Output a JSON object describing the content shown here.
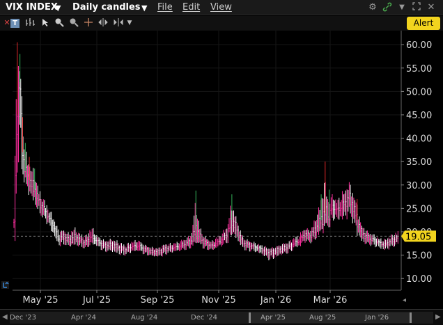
{
  "header": {
    "symbol": "VIX INDEX",
    "timeframe": "Daily candles",
    "menus": [
      "File",
      "Edit",
      "View"
    ],
    "alert_label": "Alert"
  },
  "colors": {
    "up_candle": "#ffffff",
    "down_candle": "#ff2fa0",
    "red_spike": "#e0282a",
    "green_spike": "#35b35a",
    "last_price_tag": "#f2d41e"
  },
  "last_price": "19.05",
  "navigator": {
    "labels": [
      "Dec '23",
      "Apr '24",
      "Aug '24",
      "Dec '24",
      "Apr '25",
      "Aug '25",
      "Jan '26"
    ]
  },
  "chart_data": {
    "type": "candlestick",
    "title": "",
    "ylim": [
      7.5,
      63
    ],
    "y_ticks": [
      "10.00",
      "15.00",
      "20.00",
      "25.00",
      "30.00",
      "35.00",
      "40.00",
      "45.00",
      "50.00",
      "55.00",
      "60.00"
    ],
    "x_ticks": [
      "May '25",
      "Jul '25",
      "Sep '25",
      "Nov '25",
      "Jan '26",
      "Mar '26"
    ],
    "reference_line": 19.05,
    "series": [
      {
        "name": "VIX INDEX",
        "x": [
          0,
          4,
          8,
          12,
          16,
          22,
          30,
          38,
          48,
          58,
          66,
          74,
          82,
          90,
          98,
          106,
          116,
          126,
          136,
          146,
          156,
          166,
          176,
          186,
          196,
          206,
          216,
          226,
          236,
          246,
          256,
          266,
          272,
          278,
          284,
          290,
          296,
          304,
          312,
          320,
          326,
          332,
          338,
          344,
          352,
          362,
          372,
          382,
          392,
          402,
          412,
          420,
          428,
          436,
          444,
          452,
          460,
          466,
          472,
          478,
          484,
          490,
          496,
          502,
          508,
          514,
          520,
          526,
          532,
          540,
          548,
          556,
          564,
          572,
          577
        ],
        "close": [
          22.0,
          45.0,
          52.0,
          37.0,
          33.0,
          31.0,
          29.0,
          26.0,
          24.0,
          21.5,
          18.5,
          19.0,
          18.0,
          18.8,
          18.2,
          17.5,
          19.0,
          17.8,
          17.0,
          17.2,
          16.6,
          16.1,
          16.8,
          17.0,
          16.2,
          15.7,
          15.6,
          16.3,
          16.5,
          16.8,
          17.3,
          18.0,
          20.5,
          19.0,
          17.8,
          17.4,
          16.9,
          17.6,
          18.3,
          19.5,
          22.5,
          21.0,
          19.0,
          17.5,
          17.2,
          16.8,
          16.2,
          15.4,
          15.8,
          16.3,
          16.7,
          17.6,
          18.0,
          19.5,
          19.0,
          20.5,
          22.5,
          24.0,
          23.0,
          25.5,
          24.5,
          25.2,
          26.0,
          27.5,
          25.5,
          22.5,
          20.0,
          19.0,
          18.6,
          18.2,
          17.6,
          17.2,
          17.9,
          18.4,
          19.05
        ],
        "high": [
          24.0,
          60.5,
          58.0,
          44.5,
          39.0,
          36.0,
          33.5,
          29.0,
          26.5,
          24.0,
          21.0,
          21.0,
          20.0,
          21.5,
          20.0,
          19.5,
          22.0,
          19.5,
          18.5,
          18.8,
          18.2,
          17.5,
          18.5,
          19.0,
          17.5,
          17.0,
          16.8,
          17.8,
          18.0,
          18.5,
          19.0,
          20.0,
          28.8,
          22.0,
          19.5,
          19.0,
          18.5,
          19.5,
          20.5,
          22.0,
          28.0,
          24.0,
          21.0,
          19.0,
          18.5,
          18.0,
          17.5,
          16.8,
          17.0,
          17.8,
          18.5,
          19.5,
          20.0,
          21.5,
          20.5,
          23.5,
          28.0,
          35.0,
          29.0,
          29.5,
          28.0,
          29.0,
          30.0,
          31.5,
          29.0,
          27.0,
          22.5,
          21.0,
          20.5,
          20.0,
          19.0,
          18.8,
          19.5,
          20.0,
          20.5
        ],
        "low": [
          20.0,
          28.0,
          36.0,
          31.0,
          29.0,
          27.5,
          25.5,
          23.0,
          21.5,
          18.5,
          16.5,
          16.5,
          16.5,
          16.8,
          16.5,
          16.0,
          16.5,
          16.0,
          15.3,
          15.3,
          14.8,
          14.5,
          15.0,
          15.2,
          14.8,
          14.5,
          14.3,
          14.7,
          15.0,
          15.3,
          15.8,
          16.3,
          17.5,
          16.8,
          16.0,
          15.8,
          15.3,
          16.0,
          16.5,
          17.3,
          19.0,
          18.0,
          16.8,
          15.8,
          15.3,
          15.0,
          14.5,
          13.5,
          14.0,
          14.8,
          15.0,
          15.8,
          16.3,
          17.3,
          17.0,
          18.0,
          19.5,
          20.0,
          20.5,
          21.5,
          21.0,
          21.5,
          21.5,
          22.5,
          21.0,
          19.0,
          17.5,
          16.8,
          16.5,
          16.3,
          15.8,
          15.5,
          16.2,
          16.5,
          17.0
        ]
      }
    ]
  }
}
